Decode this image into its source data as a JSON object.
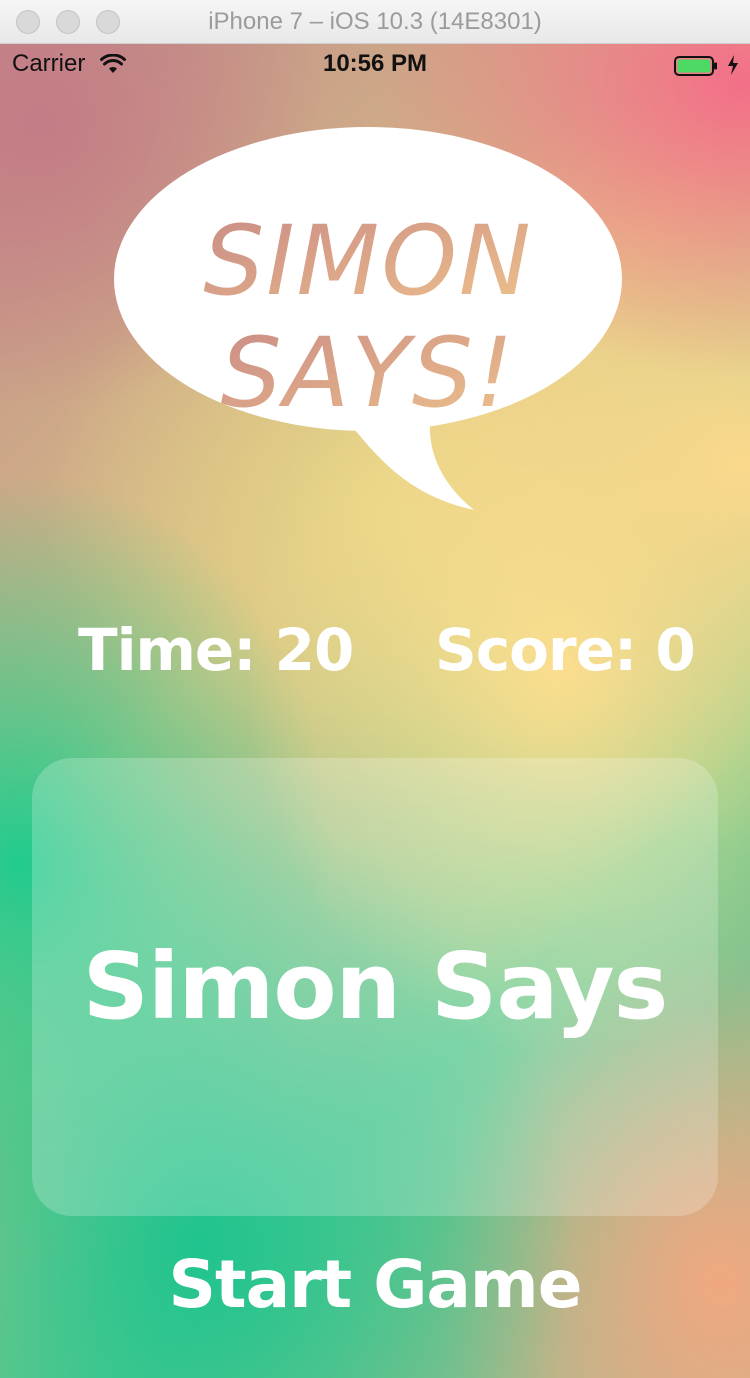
{
  "window": {
    "title": "iPhone 7 – iOS 10.3 (14E8301)"
  },
  "status_bar": {
    "carrier": "Carrier",
    "time": "10:56 PM",
    "battery_color": "#4cd964"
  },
  "logo": {
    "text_line1": "SIMON",
    "text_line2": "SAYS!"
  },
  "scoreboard": {
    "time_text": "Time: 20",
    "score_text": "Score: 0"
  },
  "command": {
    "text": "Simon Says"
  },
  "actions": {
    "start_label": "Start Game"
  },
  "colors": {
    "text": "#ffffff",
    "logo_text_top": "#c98a86",
    "logo_text_bottom": "#e8bd87"
  }
}
